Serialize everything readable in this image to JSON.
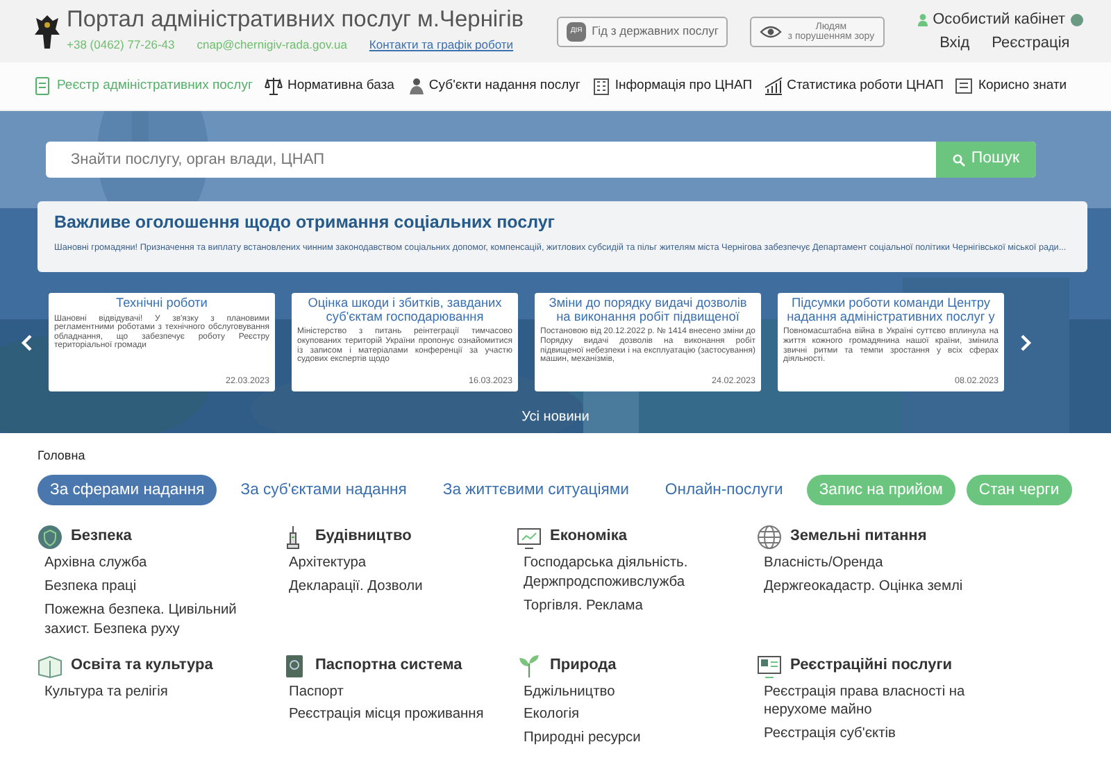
{
  "header": {
    "title": "Портал адміністративних послуг м.Чернігів",
    "phone": "+38 (0462) 77-26-43",
    "email": "cnap@chernigiv-rada.gov.ua",
    "contacts_link": "Контакти та графік роботи",
    "guide_badge": "ДІЯ",
    "guide_button": "Гід з державних послуг",
    "accessibility_line1": "Людям",
    "accessibility_line2": "з порушенням зору",
    "cabinet": "Особистий кабінет",
    "login": "Вхід",
    "register": "Реєстрація"
  },
  "nav": [
    {
      "label": "Реєстр адміністративних послуг",
      "selected": true
    },
    {
      "label": "Нормативна база",
      "selected": false
    },
    {
      "label": "Суб'єкти надання послуг",
      "selected": false
    },
    {
      "label": "Інформація про ЦНАП",
      "selected": false
    },
    {
      "label": "Статистика роботи ЦНАП",
      "selected": false
    },
    {
      "label": "Корисно знати",
      "selected": false
    }
  ],
  "search": {
    "placeholder": "Знайти послугу, орган влади, ЦНАП",
    "button": "Пошук"
  },
  "announcement": {
    "title": "Важливе оголошення щодо отримання соціальних послуг",
    "text": "Шановні громадяни! Призначення та виплату встановлених чинним законодавством соціальних допомог, компенсацій, житлових субсидій та пільг жителям міста Чернігова забезпечує Департамент соціальної політики Чернігівської міської ради..."
  },
  "news": [
    {
      "title": "Технічні роботи",
      "text": "Шановні відвідувачі! У зв'язку з плановими регламентними роботами з технічного обслуговування обладнання, що забезпечує роботу Реєстру територіальної громади",
      "date": "22.03.2023"
    },
    {
      "title": "Оцінка шкоди і збитків, завданих суб'єктам господарювання",
      "text": "Міністерство з питань реінтеграції тимчасово окупованих територій України пропонує ознайомитися із записом і матеріалами конференції за участю судових експертів щодо",
      "date": "16.03.2023"
    },
    {
      "title": "Зміни до порядку видачі дозволів на виконання робіт підвищеної",
      "text": "Постановою від 20.12.2022 р. № 1414 внесено зміни до Порядку видачі дозволів на виконання робіт підвищеної небезпеки і на експлуатацію (застосування) машин, механізмів,",
      "date": "24.02.2023"
    },
    {
      "title": "Підсумки роботи команди Центру надання адміністративних послуг у",
      "text": "Повномасштабна війна в Україні суттєво вплинула на життя кожного громадянина нашої країни, змінила звичні ритми та темпи зростання у всіх сферах діяльності.",
      "date": "08.02.2023"
    }
  ],
  "all_news": "Усі новини",
  "breadcrumb": "Головна",
  "tabs": [
    {
      "label": "За сферами надання",
      "kind": "tab",
      "selected": true
    },
    {
      "label": "За суб'єктами надання",
      "kind": "tab",
      "selected": false
    },
    {
      "label": "За життєвими ситуаціями",
      "kind": "tab",
      "selected": false
    },
    {
      "label": "Онлайн-послуги",
      "kind": "tab",
      "selected": false
    },
    {
      "label": "Запис на прийом",
      "kind": "action"
    },
    {
      "label": "Стан черги",
      "kind": "action"
    }
  ],
  "categories": [
    {
      "title": "Безпека",
      "items": [
        "Архівна служба",
        "Безпека праці",
        "Пожежна безпека. Цивільний захист. Безпека руху"
      ]
    },
    {
      "title": "Будівництво",
      "items": [
        "Архітектура",
        "Декларації. Дозволи"
      ]
    },
    {
      "title": "Економіка",
      "items": [
        "Господарська діяльність. Держпродспоживслужба",
        "Торгівля. Реклама"
      ]
    },
    {
      "title": "Земельні питання",
      "items": [
        "Власність/Оренда",
        "Держгеокадастр. Оцінка землі"
      ]
    },
    {
      "title": "Освіта та культура",
      "items": [
        "Культура та релігія"
      ]
    },
    {
      "title": "Паспортна система",
      "items": [
        "Паспорт",
        "Реєстрація місця проживання"
      ]
    },
    {
      "title": "Природа",
      "items": [
        "Бджільництво",
        "Екологія",
        "Природні ресурси"
      ]
    },
    {
      "title": "Реєстраційні послуги",
      "items": [
        "Реєстрація права власності на нерухоме майно",
        "Реєстрація суб'єктів"
      ]
    }
  ]
}
